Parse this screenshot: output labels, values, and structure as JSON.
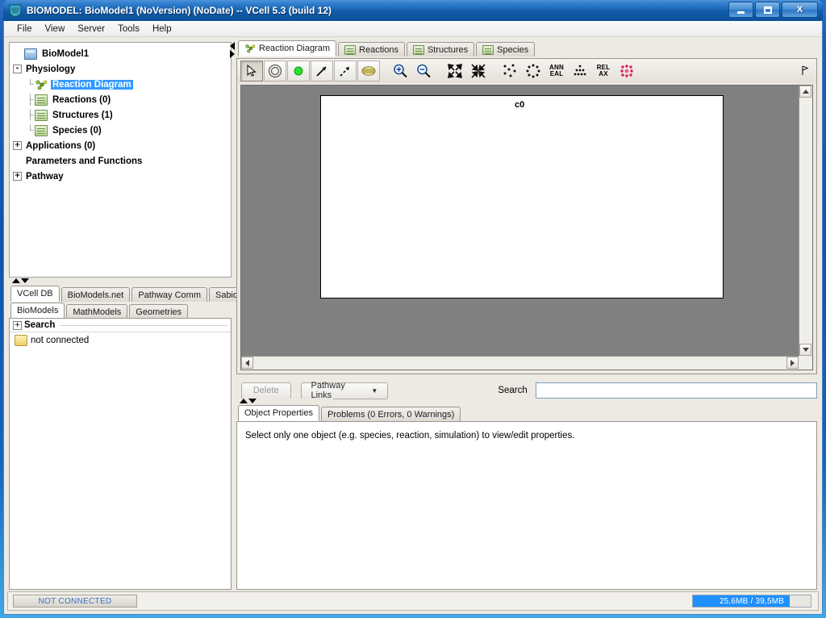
{
  "window": {
    "title": "BIOMODEL: BioModel1 (NoVersion) (NoDate) -- VCell 5.3 (build 12)",
    "app_icon": "vcell-logo-icon",
    "minimize_label": "",
    "maximize_label": "",
    "close_label": "X"
  },
  "menubar": {
    "items": [
      {
        "label": "File"
      },
      {
        "label": "View"
      },
      {
        "label": "Server"
      },
      {
        "label": "Tools"
      },
      {
        "label": "Help"
      }
    ]
  },
  "tree": {
    "nodes": [
      {
        "label": "BioModel1",
        "icon": "biomodel-document-icon",
        "toggle": "",
        "depth": 0,
        "selected": false
      },
      {
        "label": "Physiology",
        "icon": "",
        "toggle": "-",
        "depth": 0,
        "selected": false
      },
      {
        "label": "Reaction Diagram",
        "icon": "reaction-network-icon",
        "toggle": "",
        "depth": 1,
        "selected": true
      },
      {
        "label": "Reactions (0)",
        "icon": "book-icon",
        "toggle": "",
        "depth": 1,
        "selected": false
      },
      {
        "label": "Structures (1)",
        "icon": "book-icon",
        "toggle": "",
        "depth": 1,
        "selected": false
      },
      {
        "label": "Species (0)",
        "icon": "book-icon",
        "toggle": "",
        "depth": 1,
        "selected": false
      },
      {
        "label": "Applications (0)",
        "icon": "",
        "toggle": "+",
        "depth": 0,
        "selected": false
      },
      {
        "label": "Parameters and Functions",
        "icon": "",
        "toggle": "",
        "depth": 0,
        "selected": false
      },
      {
        "label": "Pathway",
        "icon": "",
        "toggle": "+",
        "depth": 0,
        "selected": false
      }
    ]
  },
  "database_panel": {
    "outer_tabs": [
      {
        "label": "VCell DB",
        "active": true
      },
      {
        "label": "BioModels.net",
        "active": false
      },
      {
        "label": "Pathway Comm",
        "active": false
      },
      {
        "label": "Sabio",
        "active": false
      }
    ],
    "inner_tabs": [
      {
        "label": "BioModels",
        "active": true
      },
      {
        "label": "MathModels",
        "active": false
      },
      {
        "label": "Geometries",
        "active": false
      }
    ],
    "search_node": {
      "label": "Search",
      "toggle": "+"
    },
    "items": [
      {
        "label": "not connected",
        "icon": "folder-icon"
      }
    ]
  },
  "editor_tabs": [
    {
      "label": "Reaction Diagram",
      "icon": "reaction-network-icon",
      "active": true
    },
    {
      "label": "Reactions",
      "icon": "book-icon",
      "active": false
    },
    {
      "label": "Structures",
      "icon": "book-icon",
      "active": false
    },
    {
      "label": "Species",
      "icon": "book-icon",
      "active": false
    }
  ],
  "diagram_toolbar": {
    "buttons": [
      {
        "name": "select-tool",
        "icon": "cursor-arrow-icon",
        "pressed": true,
        "text": ""
      },
      {
        "name": "structure-tool",
        "icon": "concentric-circle-icon",
        "pressed": false,
        "text": ""
      },
      {
        "name": "species-tool",
        "icon": "green-dot-icon",
        "pressed": false,
        "text": ""
      },
      {
        "name": "reaction-tool",
        "icon": "arrow-line-icon",
        "pressed": false,
        "text": ""
      },
      {
        "name": "flux-tool",
        "icon": "dashed-arrow-icon",
        "pressed": false,
        "text": ""
      },
      {
        "name": "membrane-tool",
        "icon": "striped-ellipse-icon",
        "pressed": false,
        "text": ""
      },
      {
        "name": "zoom-in-button",
        "icon": "zoom-in-icon",
        "pressed": false,
        "text": ""
      },
      {
        "name": "zoom-out-button",
        "icon": "zoom-out-icon",
        "pressed": false,
        "text": ""
      },
      {
        "name": "expand-layout-button",
        "icon": "expand-arrows-icon",
        "pressed": false,
        "text": ""
      },
      {
        "name": "shrink-layout-button",
        "icon": "shrink-arrows-icon",
        "pressed": false,
        "text": ""
      },
      {
        "name": "random-layout-button",
        "icon": "random-dots-icon",
        "pressed": false,
        "text": ""
      },
      {
        "name": "circle-layout-button",
        "icon": "circle-dots-icon",
        "pressed": false,
        "text": ""
      },
      {
        "name": "anneal-layout-button",
        "icon": "text-icon",
        "pressed": false,
        "text": "ANN\nEAL"
      },
      {
        "name": "grid-layout-button",
        "icon": "grid-dots-icon",
        "pressed": false,
        "text": ""
      },
      {
        "name": "relax-layout-button",
        "icon": "text-icon",
        "pressed": false,
        "text": "REL\nAX"
      },
      {
        "name": "energy-layout-button",
        "icon": "red-dots-icon",
        "pressed": false,
        "text": ""
      }
    ]
  },
  "canvas": {
    "compartment_label": "c0",
    "background_color": "#808080"
  },
  "action_bar": {
    "delete_label": "Delete",
    "delete_enabled": false,
    "pathway_links_label": "Pathway Links",
    "pathway_links_caret": "▼",
    "search_label": "Search",
    "search_value": "",
    "search_placeholder": ""
  },
  "properties": {
    "tabs": [
      {
        "label": "Object Properties",
        "active": true
      },
      {
        "label": "Problems (0 Errors, 0 Warnings)",
        "active": false
      }
    ],
    "message": "Select only one object (e.g. species, reaction, simulation) to view/edit properties."
  },
  "statusbar": {
    "connection_label": "NOT CONNECTED",
    "memory_text": "25,6MB / 39,5MB",
    "memory_used_mb": 25.6,
    "memory_total_mb": 39.5,
    "memory_percent": 82,
    "accent_color": "#1e90ff"
  }
}
